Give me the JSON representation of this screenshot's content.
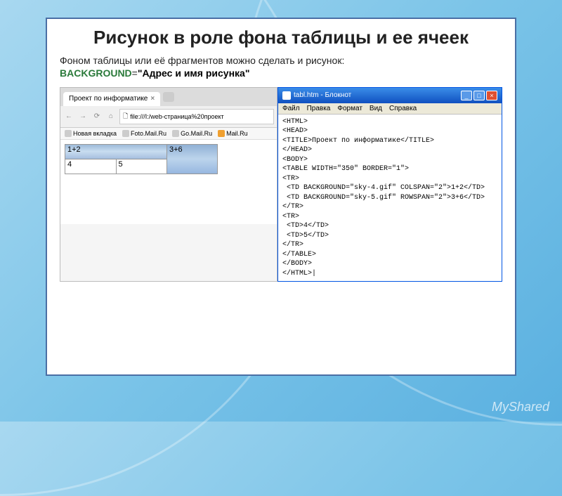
{
  "slide": {
    "title": "Рисунок в роле фона таблицы и ее ячеек",
    "desc_text": "Фоном таблицы или её фрагментов можно сделать и рисунок:",
    "attr_name": "BACKGROUND",
    "attr_eq": "=",
    "attr_value": "\"Адрес и имя рисунка\""
  },
  "browser": {
    "tab_title": "Проект по информатике",
    "tab_close": "×",
    "nav": {
      "back": "←",
      "fwd": "→",
      "reload": "⟳",
      "home": "⌂"
    },
    "url_icon": "🗋",
    "url": "file:///I:/web-страница%20проект",
    "bookmarks": [
      {
        "label": "Новая вкладка"
      },
      {
        "label": "Foto.Mail.Ru"
      },
      {
        "label": "Go.Mail.Ru"
      },
      {
        "label": "Mail.Ru"
      }
    ],
    "cells": {
      "a": "1+2",
      "b": "3+6",
      "c": "4",
      "d": "5"
    }
  },
  "notepad": {
    "title": "tabl.htm - Блокнот",
    "win": {
      "min": "_",
      "max": "□",
      "close": "×"
    },
    "menu": [
      "Файл",
      "Правка",
      "Формат",
      "Вид",
      "Справка"
    ],
    "code": "<HTML>\n<HEAD>\n<TITLE>Проект по информатике</TITLE>\n</HEAD>\n<BODY>\n<TABLE WIDTH=\"350\" BORDER=\"1\">\n<TR>\n <TD BACKGROUND=\"sky-4.gif\" COLSPAN=\"2\">1+2</TD>\n <TD BACKGROUND=\"sky-5.gif\" ROWSPAN=\"2\">3+6</TD>\n</TR>\n<TR>\n <TD>4</TD>\n <TD>5</TD>\n</TR>\n</TABLE>\n</BODY>\n</HTML>|"
  },
  "watermark": "MyShared"
}
